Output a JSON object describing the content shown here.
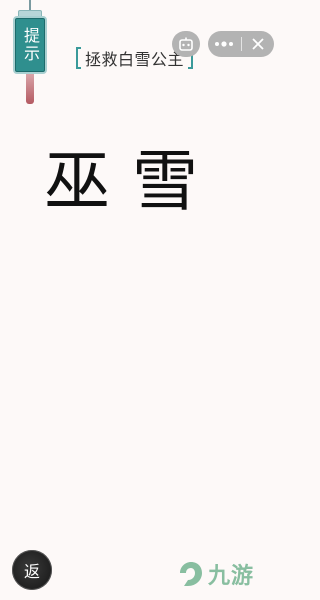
{
  "hint": {
    "label": "提示"
  },
  "title": {
    "text": "拯救白雪公主"
  },
  "capsule": {
    "more_icon": "more-dots-icon",
    "close_icon": "close-icon",
    "robot_icon": "robot-icon"
  },
  "puzzle": {
    "characters": [
      "巫",
      "雪"
    ]
  },
  "back": {
    "label": "返"
  },
  "watermark": {
    "text": "九游",
    "icon": "nine-game-logo-icon"
  },
  "colors": {
    "accent": "#2f8f8e",
    "background": "#fdf9f8",
    "tassel": "#b45a62"
  }
}
